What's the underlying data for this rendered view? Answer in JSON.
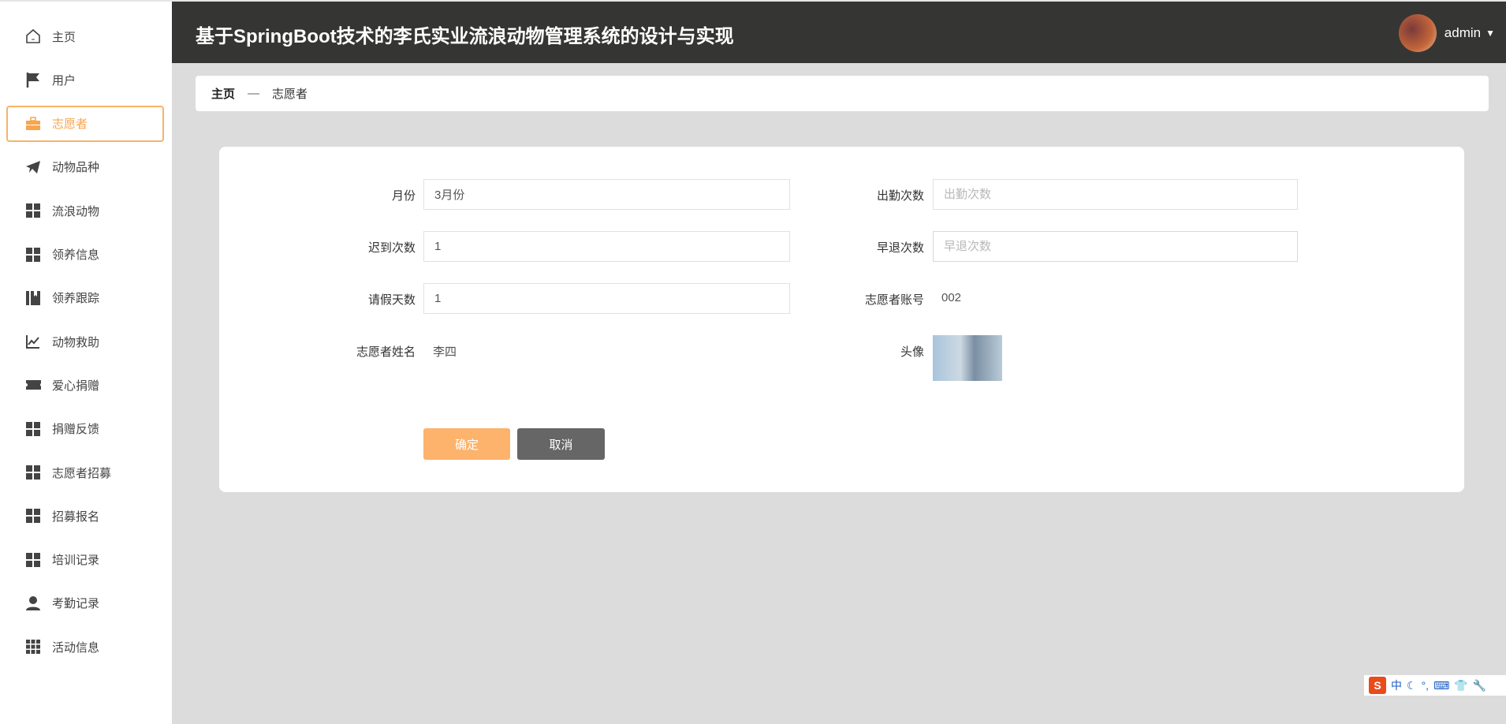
{
  "sidebar": {
    "items": [
      {
        "label": "主页",
        "icon": "home-icon"
      },
      {
        "label": "用户",
        "icon": "flag-icon"
      },
      {
        "label": "志愿者",
        "icon": "briefcase-icon",
        "active": true
      },
      {
        "label": "动物品种",
        "icon": "paper-plane-icon"
      },
      {
        "label": "流浪动物",
        "icon": "grid-icon"
      },
      {
        "label": "领养信息",
        "icon": "grid-icon"
      },
      {
        "label": "领养跟踪",
        "icon": "book-icon"
      },
      {
        "label": "动物救助",
        "icon": "chart-line-icon"
      },
      {
        "label": "爱心捐赠",
        "icon": "ticket-icon"
      },
      {
        "label": "捐赠反馈",
        "icon": "grid-icon"
      },
      {
        "label": "志愿者招募",
        "icon": "grid-icon"
      },
      {
        "label": "招募报名",
        "icon": "grid-icon"
      },
      {
        "label": "培训记录",
        "icon": "grid-icon"
      },
      {
        "label": "考勤记录",
        "icon": "user-icon"
      },
      {
        "label": "活动信息",
        "icon": "apps-icon"
      }
    ],
    "accent": "#f7a54f"
  },
  "header": {
    "title": "基于SpringBoot技术的李氏实业流浪动物管理系统的设计与实现",
    "user": "admin"
  },
  "breadcrumb": {
    "home": "主页",
    "sep": "—",
    "current": "志愿者"
  },
  "form": {
    "month": {
      "label": "月份",
      "value": "3月份",
      "placeholder": "月份"
    },
    "attendance": {
      "label": "出勤次数",
      "value": "",
      "placeholder": "出勤次数"
    },
    "late": {
      "label": "迟到次数",
      "value": "1",
      "placeholder": "迟到次数"
    },
    "early": {
      "label": "早退次数",
      "value": "",
      "placeholder": "早退次数"
    },
    "leave": {
      "label": "请假天数",
      "value": "1",
      "placeholder": "请假天数"
    },
    "account": {
      "label": "志愿者账号",
      "value": "002"
    },
    "name": {
      "label": "志愿者姓名",
      "value": "李四"
    },
    "avatar": {
      "label": "头像"
    },
    "confirm": "确定",
    "cancel": "取消"
  },
  "ime": {
    "lang": "中"
  }
}
